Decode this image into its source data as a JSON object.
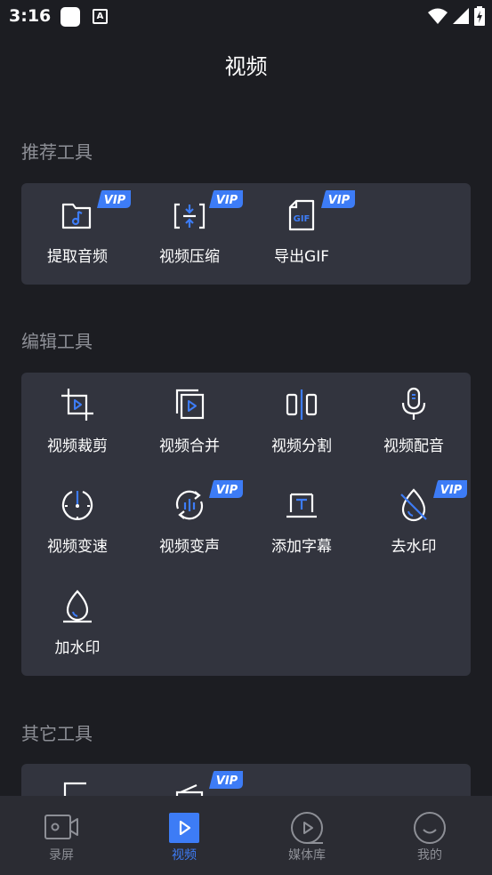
{
  "status_bar": {
    "time": "3:16"
  },
  "page_title": "视频",
  "sections": {
    "recommended": {
      "title": "推荐工具",
      "tools": [
        {
          "label": "提取音频",
          "icon": "music-folder-icon",
          "vip": "VIP"
        },
        {
          "label": "视频压缩",
          "icon": "compress-icon",
          "vip": "VIP"
        },
        {
          "label": "导出GIF",
          "icon": "gif-file-icon",
          "vip": "VIP"
        }
      ]
    },
    "edit": {
      "title": "编辑工具",
      "tools": [
        {
          "label": "视频裁剪",
          "icon": "crop-icon"
        },
        {
          "label": "视频合并",
          "icon": "merge-icon"
        },
        {
          "label": "视频分割",
          "icon": "split-icon"
        },
        {
          "label": "视频配音",
          "icon": "microphone-icon"
        },
        {
          "label": "视频变速",
          "icon": "speed-icon"
        },
        {
          "label": "视频变声",
          "icon": "voice-change-icon",
          "vip": "VIP"
        },
        {
          "label": "添加字幕",
          "icon": "subtitle-icon"
        },
        {
          "label": "去水印",
          "icon": "remove-watermark-icon",
          "vip": "VIP"
        },
        {
          "label": "加水印",
          "icon": "add-watermark-icon"
        }
      ]
    },
    "other": {
      "title": "其它工具",
      "tools": [
        {
          "icon": "edit-icon"
        },
        {
          "icon": "radio-icon",
          "vip": "VIP"
        }
      ]
    }
  },
  "bottom_nav": [
    {
      "label": "录屏",
      "icon": "record-screen-icon",
      "active": false
    },
    {
      "label": "视频",
      "icon": "video-play-icon",
      "active": true
    },
    {
      "label": "媒体库",
      "icon": "media-library-icon",
      "active": false
    },
    {
      "label": "我的",
      "icon": "profile-icon",
      "active": false
    }
  ],
  "colors": {
    "background": "#1c1d22",
    "card": "#32343e",
    "accent": "#3d7cf6",
    "muted_text": "#8d8f96",
    "nav_bg": "#2b2c33"
  }
}
